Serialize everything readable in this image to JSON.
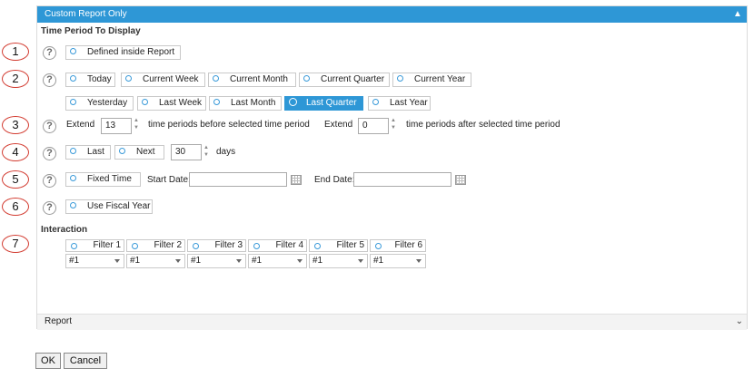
{
  "panel": {
    "title": "Custom Report Only",
    "collapse_icon": "chevron-up-icon",
    "time_period_title": "Time Period To Display",
    "interaction_title": "Interaction",
    "report_section": "Report",
    "report_icon": "chevron-down-icon"
  },
  "markers": [
    "1",
    "2",
    "3",
    "4",
    "5",
    "6",
    "7"
  ],
  "help_glyph": "?",
  "row1": {
    "defined_inside_report": "Defined inside Report"
  },
  "row2": {
    "top": [
      "Today",
      "Current Week",
      "Current Month",
      "Current Quarter",
      "Current Year"
    ],
    "bottom": [
      "Yesterday",
      "Last Week",
      "Last Month",
      "Last Quarter",
      "Last Year"
    ],
    "selected": "Last Quarter"
  },
  "row3": {
    "extend_before_label": "Extend",
    "before_value": "13",
    "before_text": "time periods before selected time period",
    "extend_after_label": "Extend",
    "after_value": "0",
    "after_text": "time periods after selected time period"
  },
  "row4": {
    "last": "Last",
    "next": "Next",
    "days_value": "30",
    "days_label": "days"
  },
  "row5": {
    "fixed_time": "Fixed Time",
    "start_date_label": "Start Date:",
    "end_date_label": "End Date:",
    "start_value": "",
    "end_value": ""
  },
  "row6": {
    "use_fiscal_year": "Use Fiscal Year"
  },
  "filters": [
    {
      "label": "Filter 1",
      "value": "#1"
    },
    {
      "label": "Filter 2",
      "value": "#1"
    },
    {
      "label": "Filter 3",
      "value": "#1"
    },
    {
      "label": "Filter 4",
      "value": "#1"
    },
    {
      "label": "Filter 5",
      "value": "#1"
    },
    {
      "label": "Filter 6",
      "value": "#1"
    }
  ],
  "buttons": {
    "ok": "OK",
    "cancel": "Cancel"
  },
  "colors": {
    "accent": "#2e97d6",
    "marker_border": "#d23a2f"
  }
}
